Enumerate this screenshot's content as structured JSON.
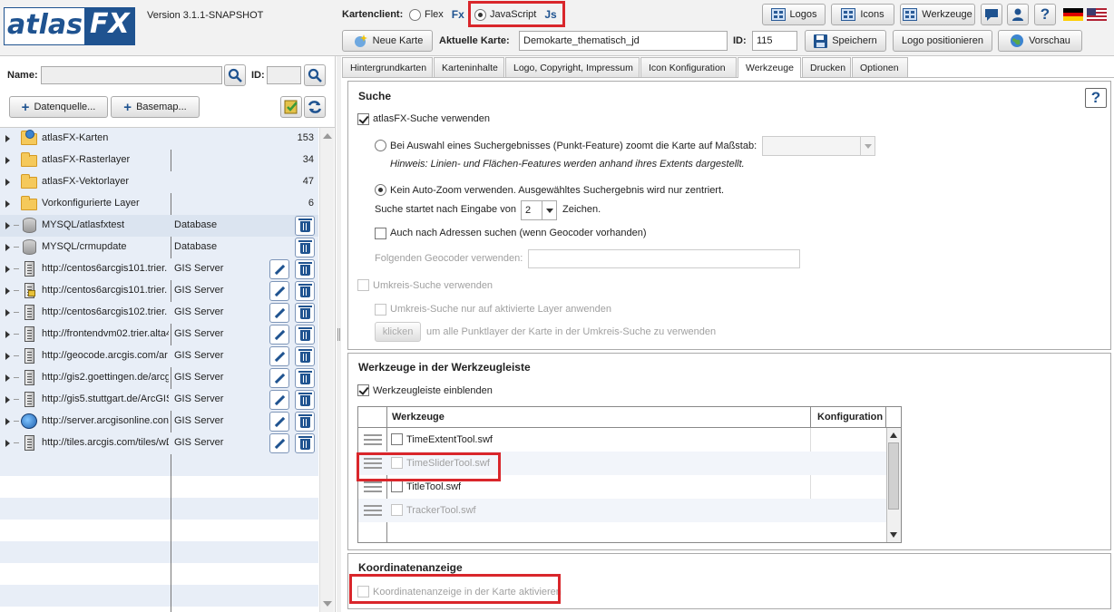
{
  "header": {
    "logo_left": "atlas",
    "logo_right": "FX",
    "version": "Version 3.1.1-SNAPSHOT",
    "client_label": "Kartenclient:",
    "client_options": [
      {
        "label": "Flex",
        "badge": "Fx",
        "selected": false
      },
      {
        "label": "JavaScript",
        "badge": "Js",
        "selected": true
      }
    ],
    "buttons": {
      "logos": "Logos",
      "icons": "Icons",
      "tools": "Werkzeuge"
    },
    "new_map": "Neue Karte",
    "current_map_label": "Aktuelle Karte:",
    "current_map_value": "Demokarte_thematisch_jd",
    "id_label": "ID:",
    "id_value": "115",
    "save": "Speichern",
    "logo_position": "Logo positionieren",
    "preview": "Vorschau",
    "help": "?"
  },
  "left": {
    "name_label": "Name:",
    "id_label": "ID:",
    "add_datasource": "Datenquelle...",
    "add_basemap": "Basemap...",
    "rows": [
      {
        "label": "atlasFX-Karten",
        "type": "",
        "count": "153",
        "icon": "globe-folder-icon",
        "edit": false
      },
      {
        "label": "atlasFX-Rasterlayer",
        "type": "",
        "count": "34",
        "icon": "folder-icon",
        "edit": false
      },
      {
        "label": "atlasFX-Vektorlayer",
        "type": "",
        "count": "47",
        "icon": "folder-icon",
        "edit": false
      },
      {
        "label": "Vorkonfigurierte Layer",
        "type": "",
        "count": "6",
        "icon": "folder-icon",
        "edit": false
      },
      {
        "label": "MYSQL/atlasfxtest",
        "type": "Database",
        "count": "",
        "icon": "database-icon",
        "edit": false,
        "delete": true
      },
      {
        "label": "MYSQL/crmupdate",
        "type": "Database",
        "count": "",
        "icon": "database-icon",
        "edit": false,
        "delete": true
      },
      {
        "label": "http://centos6arcgis101.trier.",
        "type": "GIS Server",
        "count": "",
        "icon": "server-icon",
        "edit": true,
        "delete": true
      },
      {
        "label": "http://centos6arcgis101.trier.",
        "type": "GIS Server",
        "count": "",
        "icon": "locked-server-icon",
        "edit": true,
        "delete": true
      },
      {
        "label": "http://centos6arcgis102.trier.",
        "type": "GIS Server",
        "count": "",
        "icon": "server-icon",
        "edit": true,
        "delete": true
      },
      {
        "label": "http://frontendvm02.trier.alta4",
        "type": "GIS Server",
        "count": "",
        "icon": "server-icon",
        "edit": true,
        "delete": true
      },
      {
        "label": "http://geocode.arcgis.com/ar",
        "type": "GIS Server",
        "count": "",
        "icon": "server-icon",
        "edit": true,
        "delete": true
      },
      {
        "label": "http://gis2.goettingen.de/arcg",
        "type": "GIS Server",
        "count": "",
        "icon": "server-icon",
        "edit": true,
        "delete": true
      },
      {
        "label": "http://gis5.stuttgart.de/ArcGIS",
        "type": "GIS Server",
        "count": "",
        "icon": "server-icon",
        "edit": true,
        "delete": true
      },
      {
        "label": "http://server.arcgisonline.con",
        "type": "GIS Server",
        "count": "",
        "icon": "globe-icon",
        "edit": true,
        "delete": true
      },
      {
        "label": "http://tiles.arcgis.com/tiles/wD",
        "type": "GIS Server",
        "count": "",
        "icon": "server-icon",
        "edit": true,
        "delete": true
      }
    ]
  },
  "tabs": [
    {
      "label": "Hintergrundkarten",
      "active": false
    },
    {
      "label": "Karteninhalte",
      "active": false
    },
    {
      "label": "Logo, Copyright, Impressum",
      "active": false
    },
    {
      "label": "Icon Konfiguration",
      "active": false
    },
    {
      "label": "Werkzeuge",
      "active": true
    },
    {
      "label": "Drucken",
      "active": false
    },
    {
      "label": "Optionen",
      "active": false
    }
  ],
  "search": {
    "title": "Suche",
    "enable": "atlasFX-Suche verwenden",
    "zoom_option": "Bei Auswahl eines Suchergebnisses (Punkt-Feature) zoomt die Karte auf Maßstab:",
    "hint": "Hinweis: Linien- und Flächen-Features werden anhand ihres Extents dargestellt.",
    "no_zoom_option": "Kein Auto-Zoom verwenden. Ausgewähltes Suchergebnis wird nur zentriert.",
    "start_prefix": "Suche startet nach Eingabe von",
    "start_value": "2",
    "start_suffix": "Zeichen.",
    "address": "Auch nach Adressen suchen (wenn Geocoder vorhanden)",
    "geocoder": "Folgenden Geocoder verwenden:",
    "radius": "Umkreis-Suche verwenden",
    "radius_only_active": "Umkreis-Suche nur auf aktivierte Layer anwenden",
    "click_btn": "klicken",
    "click_text": "um alle Punktlayer der Karte in der Umkreis-Suche zu verwenden"
  },
  "tools": {
    "title": "Werkzeuge in der Werkzeugleiste",
    "show": "Werkzeugleiste einblenden",
    "col_tools": "Werkzeuge",
    "col_config": "Konfiguration",
    "items": [
      {
        "name": "TimeExtentTool.swf",
        "enabled": true
      },
      {
        "name": "TimeSliderTool.swf",
        "enabled": false
      },
      {
        "name": "TitleTool.swf",
        "enabled": true
      },
      {
        "name": "TrackerTool.swf",
        "enabled": false
      }
    ]
  },
  "coords": {
    "title": "Koordinatenanzeige",
    "enable": "Koordinatenanzeige in der Karte aktivieren"
  }
}
